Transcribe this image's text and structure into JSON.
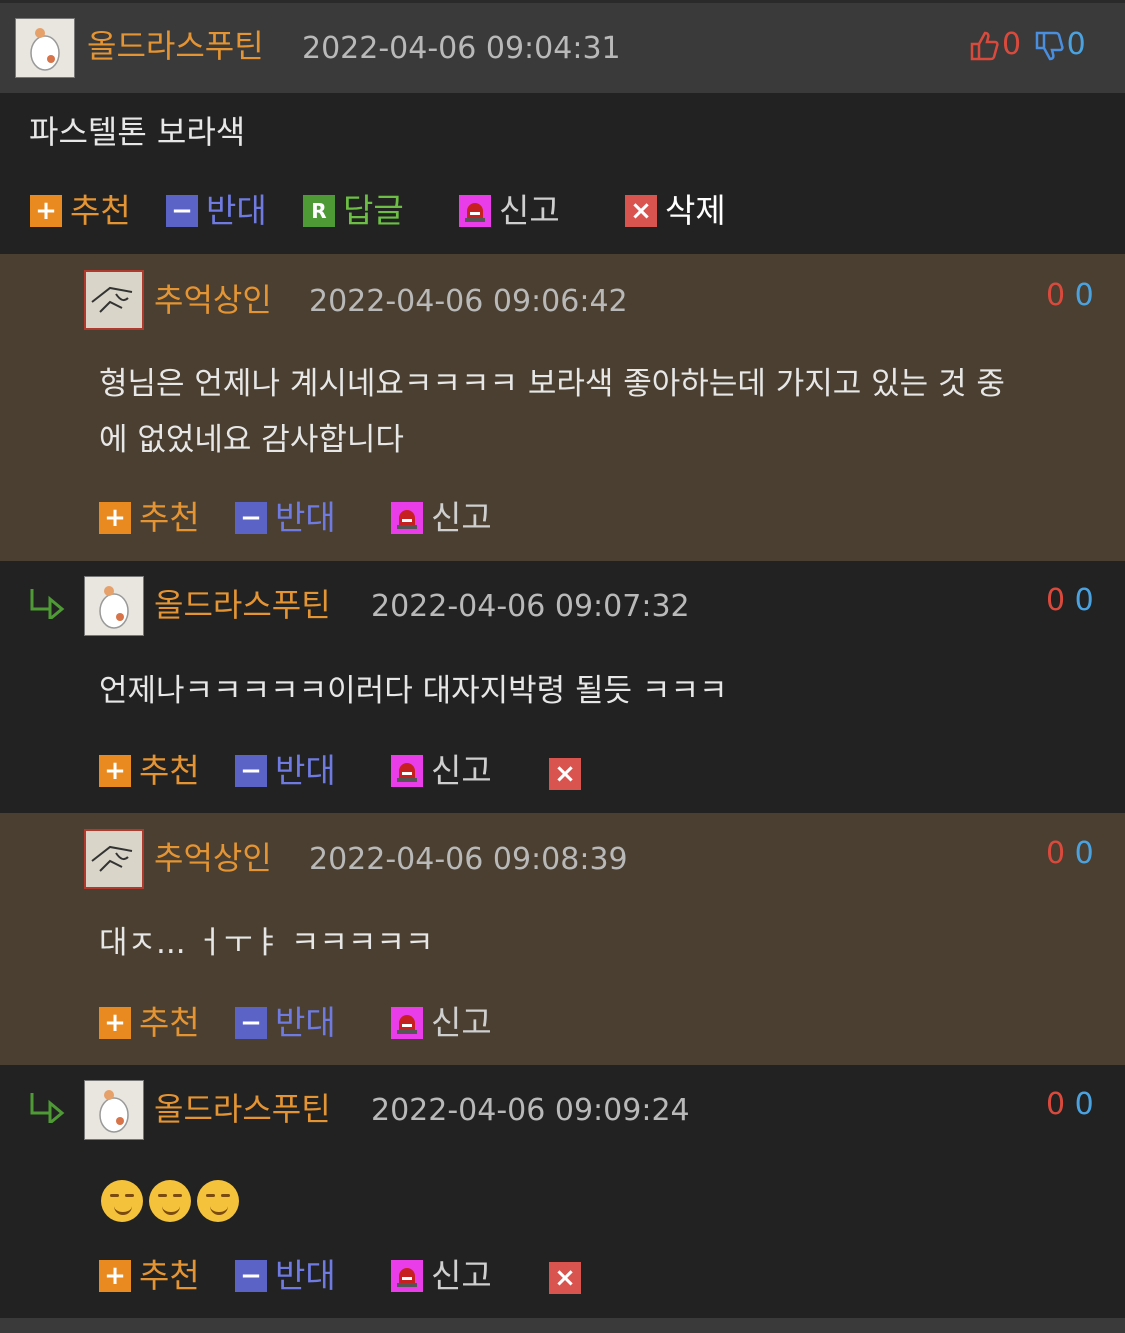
{
  "root": {
    "username": "올드라스푸틴",
    "timestamp": "2022-04-06 09:04:31",
    "upvotes": "0",
    "downvotes": "0",
    "text": "파스텔톤 보라색",
    "actions": {
      "recommend": "추천",
      "oppose": "반대",
      "reply_icon": "R",
      "reply": "답글",
      "report": "신고",
      "delete": "삭제"
    }
  },
  "comments": [
    {
      "username": "추억상인",
      "timestamp": "2022-04-06 09:06:42",
      "up": "0",
      "down": "0",
      "text_line1": "형님은 언제나 계시네요ㅋㅋㅋㅋ 보라색 좋아하는데 가지고 있는 것 중",
      "text_line2": "에 없었네요 감사합니다",
      "recommend": "추천",
      "oppose": "반대",
      "report": "신고"
    },
    {
      "username": "올드라스푸틴",
      "timestamp": "2022-04-06 09:07:32",
      "up": "0",
      "down": "0",
      "text": "언제나ㅋㅋㅋㅋㅋ이러다 대자지박령 될듯 ㅋㅋㅋ",
      "recommend": "추천",
      "oppose": "반대",
      "report": "신고"
    },
    {
      "username": "추억상인",
      "timestamp": "2022-04-06 09:08:39",
      "up": "0",
      "down": "0",
      "text": "대ㅈ... ㅓㅜㅑ ㅋㅋㅋㅋㅋ",
      "recommend": "추천",
      "oppose": "반대",
      "report": "신고"
    },
    {
      "username": "올드라스푸틴",
      "timestamp": "2022-04-06 09:09:24",
      "up": "0",
      "down": "0",
      "text": "😏😏😏",
      "recommend": "추천",
      "oppose": "반대",
      "report": "신고"
    }
  ],
  "icons": {
    "plus": "+",
    "minus": "−",
    "delete": "×"
  },
  "colors": {
    "username": "#e49433",
    "reply_bg_nested": "#4a3f30",
    "bg": "#222222",
    "header_bg": "#3a3a3a"
  }
}
